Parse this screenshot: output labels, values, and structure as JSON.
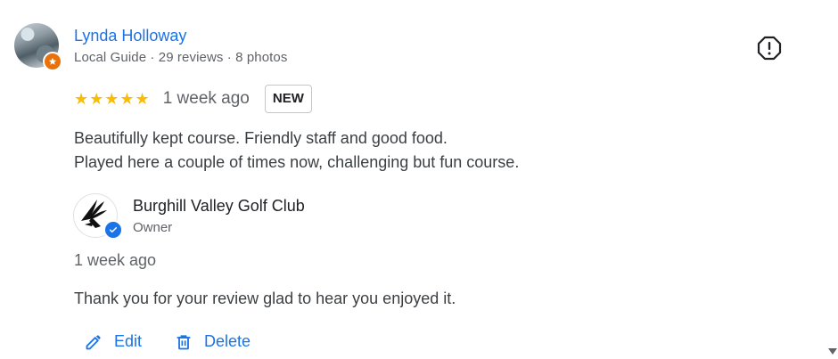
{
  "review": {
    "reviewer_name": "Lynda Holloway",
    "reviewer_meta": "Local Guide · 29 reviews · 8 photos",
    "stars": "★★★★★",
    "rating": 5,
    "date": "1 week ago",
    "badge": "NEW",
    "text_line1": "Beautifully kept course. Friendly staff and good food.",
    "text_line2": "Played here a couple of times now, challenging but fun course."
  },
  "owner_reply": {
    "name": "Burghill Valley Golf Club",
    "role": "Owner",
    "date": "1 week ago",
    "text": "Thank you for your review glad to hear you enjoyed it."
  },
  "actions": {
    "edit_label": "Edit",
    "delete_label": "Delete"
  },
  "icons": {
    "avatar": "reviewer-avatar",
    "guide_badge": "local-guide-star-icon",
    "report": "report-icon",
    "owner_logo": "eagle-logo",
    "verified": "verified-check-icon",
    "edit": "pencil-icon",
    "delete": "trash-icon"
  },
  "colors": {
    "accent": "#1a73e8",
    "star": "#fbbc04",
    "guide_badge": "#e8710a"
  }
}
